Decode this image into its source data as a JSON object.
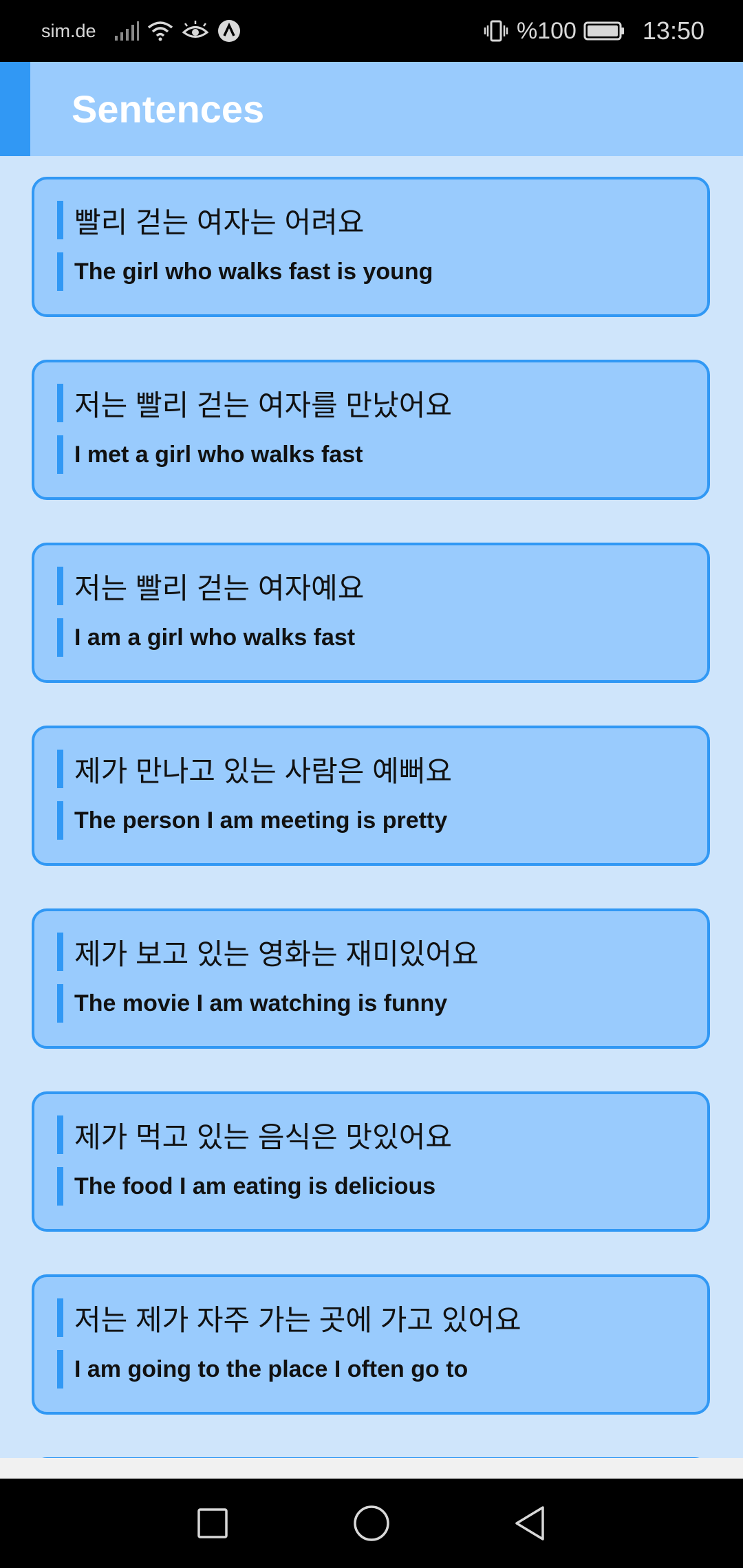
{
  "status_bar": {
    "carrier": "sim.de",
    "battery_percent": "%100",
    "time": "13:50",
    "icons": [
      "signal-icon",
      "wifi-icon",
      "eye-icon",
      "vpn-icon",
      "vibrate-icon",
      "battery-icon"
    ]
  },
  "app_bar": {
    "title": "Sentences"
  },
  "colors": {
    "background": "#cfe5fb",
    "card": "#99cbfd",
    "accent": "#3198f4"
  },
  "sentences": [
    {
      "korean": "빨리 걷는 여자는 어려요",
      "english": "The girl who walks fast is young"
    },
    {
      "korean": "저는 빨리 걷는 여자를 만났어요",
      "english": "I met a girl who walks fast"
    },
    {
      "korean": "저는 빨리 걷는 여자예요",
      "english": "I am a girl who walks fast"
    },
    {
      "korean": "제가 만나고 있는 사람은 예뻐요",
      "english": "The person I am meeting is pretty"
    },
    {
      "korean": "제가 보고 있는 영화는 재미있어요",
      "english": "The movie I am watching is funny"
    },
    {
      "korean": "제가 먹고 있는 음식은 맛있어요",
      "english": "The food I am eating is delicious"
    },
    {
      "korean": "저는 제가 자주 가는 곳에 가고 있어요",
      "english": "I am going to the place I often go to"
    }
  ],
  "nav_bar": {
    "icons": [
      "recents-icon",
      "home-icon",
      "back-icon"
    ]
  }
}
